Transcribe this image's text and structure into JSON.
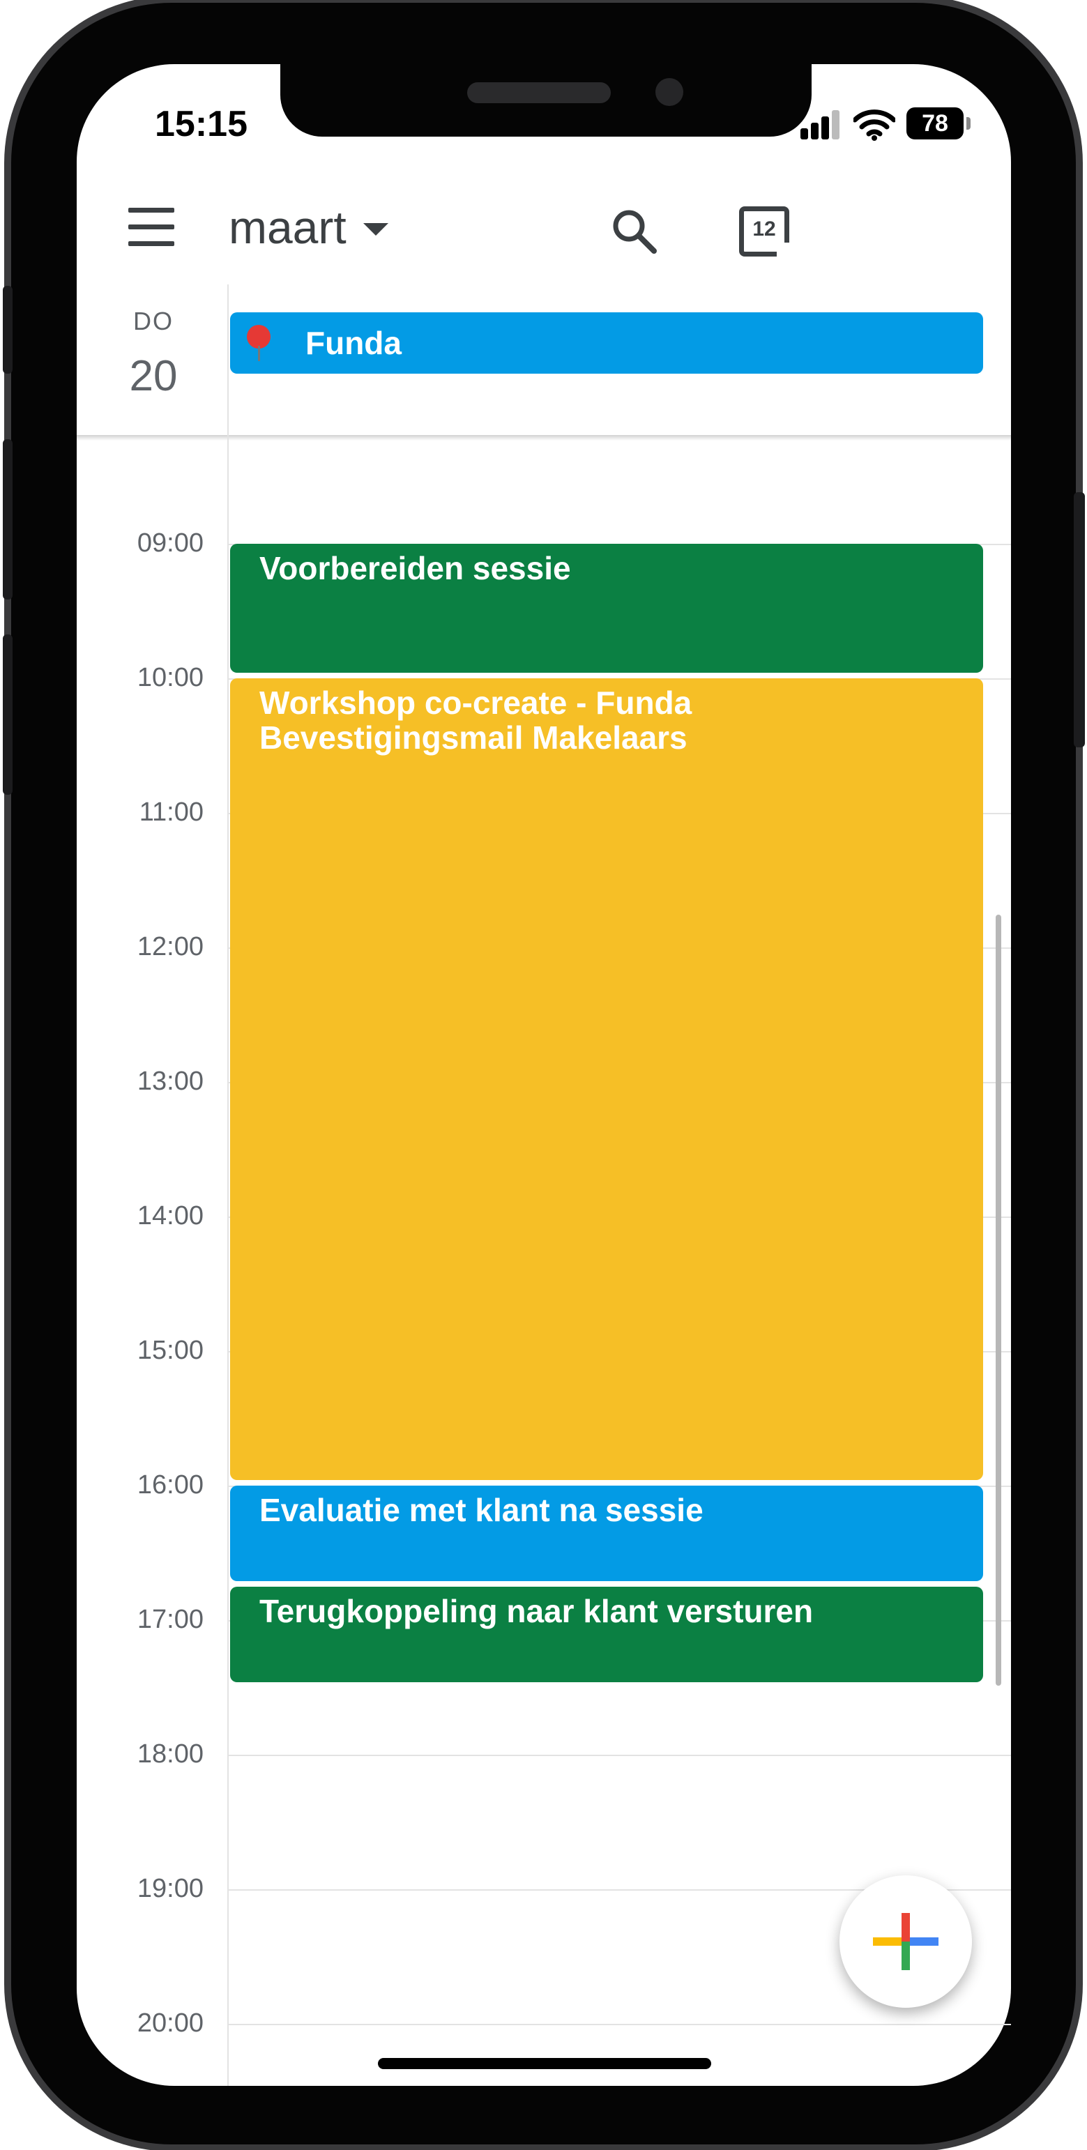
{
  "status_bar": {
    "time": "15:15",
    "battery": "78"
  },
  "toolbar": {
    "month": "maart",
    "today_date": "12"
  },
  "day": {
    "weekday": "DO",
    "date": "20"
  },
  "all_day_event": {
    "title": "Funda",
    "color": "#039be5"
  },
  "hours": [
    "09:00",
    "10:00",
    "11:00",
    "12:00",
    "13:00",
    "14:00",
    "15:00",
    "16:00",
    "17:00",
    "18:00",
    "19:00",
    "20:00"
  ],
  "events": [
    {
      "title": "Voorbereiden sessie",
      "subtitle": "",
      "start": "09:00",
      "end": "10:00",
      "color": "#0b8043"
    },
    {
      "title": "Workshop co-create - Funda",
      "subtitle": "Bevestigingsmail Makelaars",
      "start": "10:00",
      "end": "16:00",
      "color": "#f6bf26"
    },
    {
      "title": "Evaluatie met klant na sessie",
      "subtitle": "",
      "start": "16:00",
      "end": "16:45",
      "color": "#039be5"
    },
    {
      "title": "Terugkoppeling naar klant versturen",
      "subtitle": "",
      "start": "16:45",
      "end": "17:30",
      "color": "#0b8043"
    }
  ],
  "fab": {
    "icon": "plus-icon"
  }
}
